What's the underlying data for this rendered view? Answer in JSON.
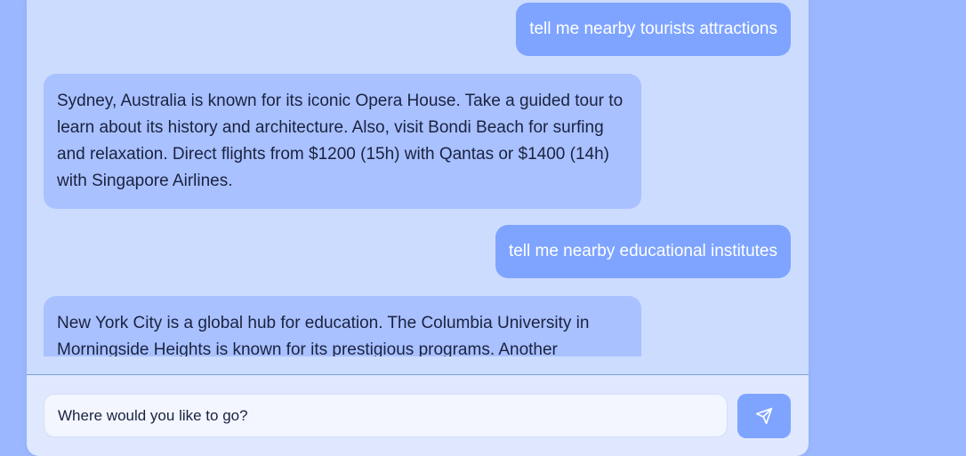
{
  "messages": [
    {
      "role": "user",
      "text": "tell me nearby tourists attractions"
    },
    {
      "role": "assistant",
      "text": "Sydney, Australia is known for its iconic Opera House. Take a guided tour to learn about its history and architecture. Also, visit Bondi Beach for surfing and relaxation. Direct flights from $1200 (15h) with Qantas or $1400 (14h) with Singapore Airlines."
    },
    {
      "role": "user",
      "text": "tell me nearby educational institutes"
    },
    {
      "role": "assistant",
      "text": "New York City is a global hub for education. The Columbia University in Morningside Heights is known for its prestigious programs. Another"
    }
  ],
  "composer": {
    "placeholder": "Where would you like to go?",
    "send_icon": "send-icon"
  },
  "colors": {
    "page_background": "#9bb7ff",
    "panel_background": "#ccdcff",
    "user_bubble": "#7ea4ff",
    "assistant_bubble": "#a9c1ff",
    "accent": "#7ea4ff"
  }
}
